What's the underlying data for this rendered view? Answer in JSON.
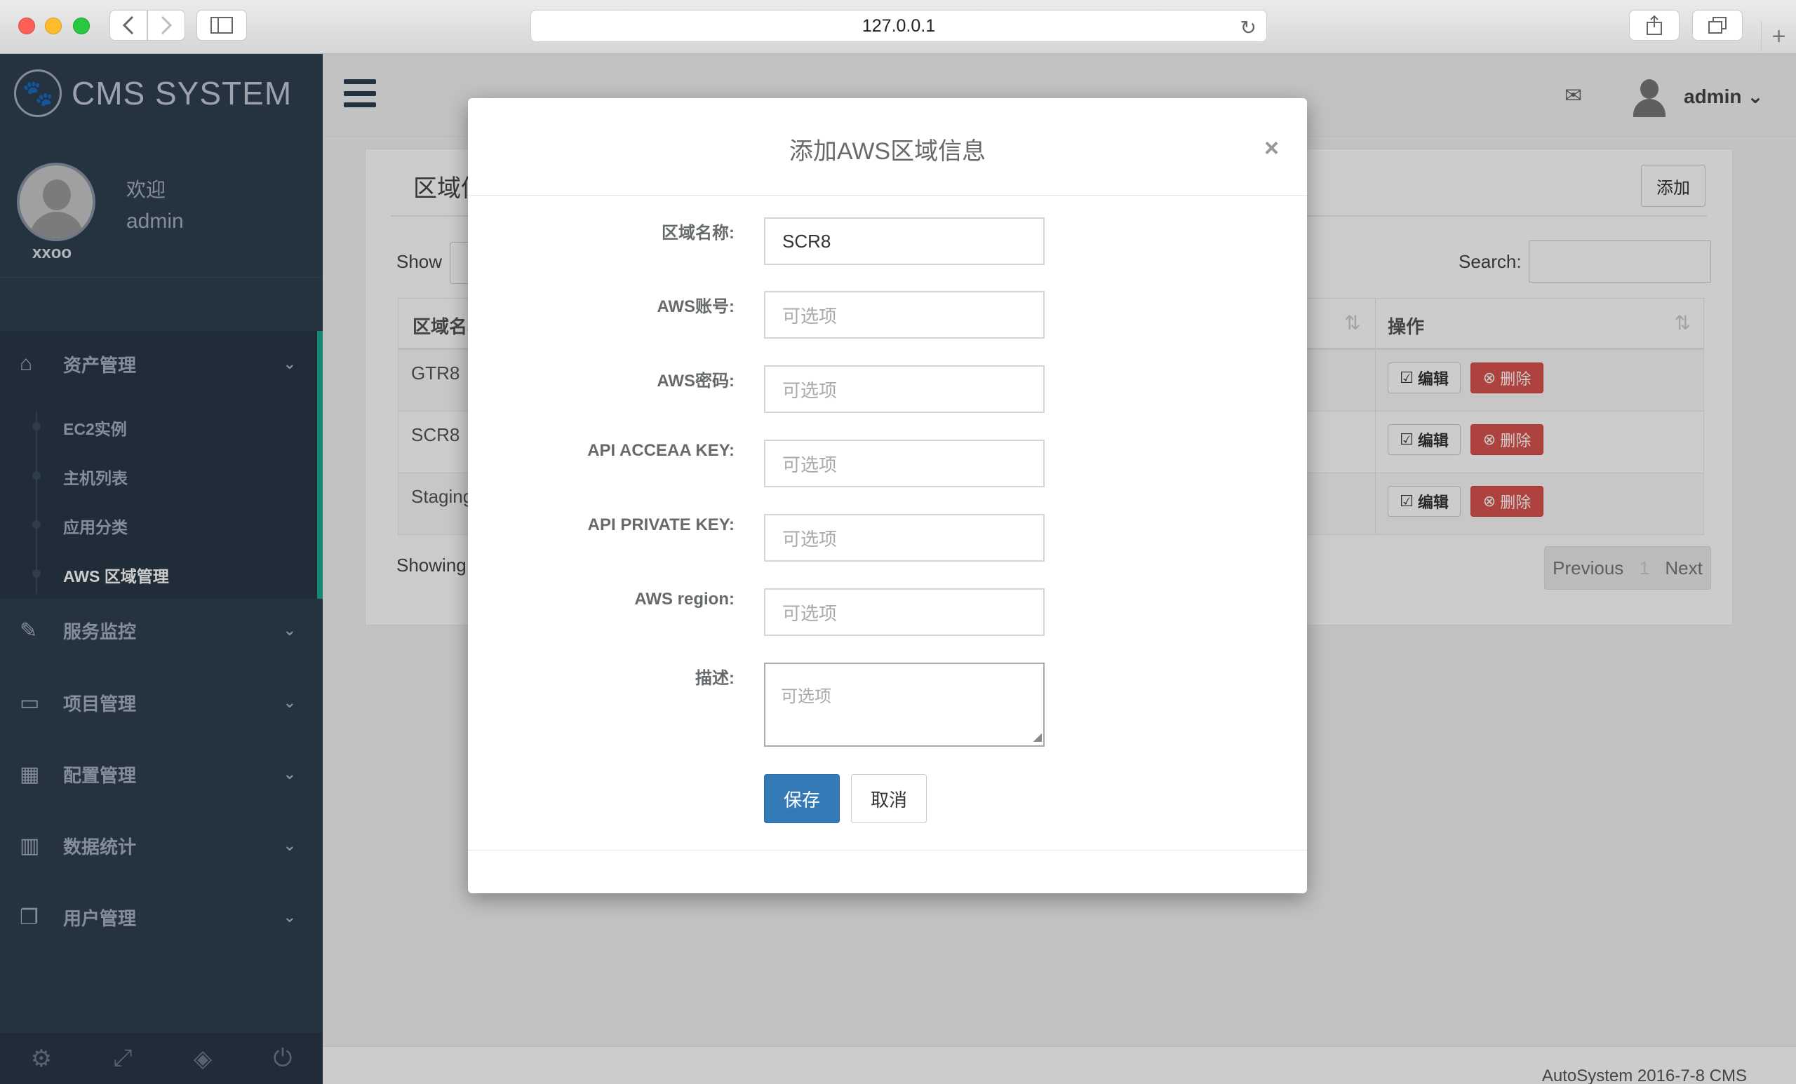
{
  "browser": {
    "url": "127.0.0.1",
    "new_tab": "+"
  },
  "sidebar": {
    "brand": "CMS SYSTEM",
    "welcome": "欢迎",
    "welcome_user": "admin",
    "user_label": "xxoo",
    "menu": [
      {
        "label": "资产管理",
        "icon": "home-icon"
      },
      {
        "label": "服务监控",
        "icon": "edit-icon"
      },
      {
        "label": "项目管理",
        "icon": "desktop-icon"
      },
      {
        "label": "配置管理",
        "icon": "table-icon"
      },
      {
        "label": "数据统计",
        "icon": "bar-chart-icon"
      },
      {
        "label": "用户管理",
        "icon": "copy-icon"
      }
    ],
    "submenu": [
      "EC2实例",
      "主机列表",
      "应用分类",
      "AWS 区域管理"
    ],
    "accent_color": "#19aa8d"
  },
  "topbar": {
    "user": "admin"
  },
  "panel": {
    "title": "区域信息",
    "add_label": "添加",
    "show_label": "Show",
    "search_label": "Search:",
    "columns": {
      "name": "区域名称",
      "actions": "操作"
    },
    "rows": [
      {
        "name": "GTR8",
        "edit": "编辑",
        "delete": "删除"
      },
      {
        "name": "SCR8",
        "edit": "编辑",
        "delete": "删除"
      },
      {
        "name": "Staging",
        "edit": "编辑",
        "delete": "删除"
      }
    ],
    "showing": "Showing",
    "pagination": {
      "prev": "Previous",
      "page": "1",
      "next": "Next"
    }
  },
  "footer": {
    "text": "AutoSystem 2016-7-8 CMS"
  },
  "modal": {
    "title": "添加AWS区域信息",
    "close": "×",
    "fields": [
      {
        "label": "区域名称:",
        "value": "SCR8",
        "placeholder": ""
      },
      {
        "label": "AWS账号:",
        "value": "",
        "placeholder": "可选项"
      },
      {
        "label": "AWS密码:",
        "value": "",
        "placeholder": "可选项"
      },
      {
        "label": "API ACCEAA KEY:",
        "value": "",
        "placeholder": "可选项"
      },
      {
        "label": "API PRIVATE KEY:",
        "value": "",
        "placeholder": "可选项"
      },
      {
        "label": "AWS region:",
        "value": "",
        "placeholder": "可选项"
      }
    ],
    "description": {
      "label": "描述:",
      "placeholder": "可选项"
    },
    "save_label": "保存",
    "cancel_label": "取消",
    "primary_color": "#337ab7",
    "danger_color": "#d9534f"
  }
}
